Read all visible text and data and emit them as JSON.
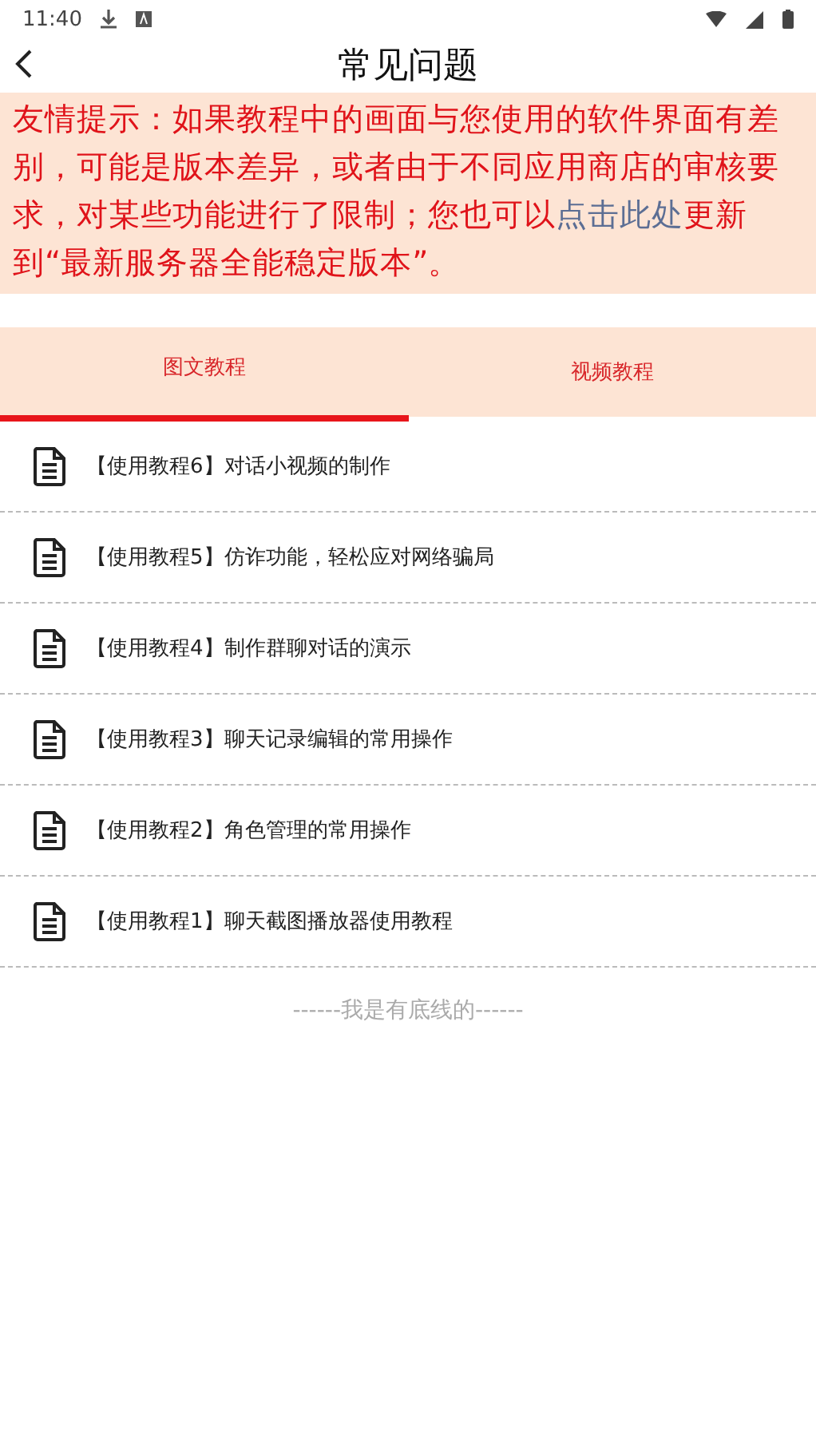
{
  "status_bar": {
    "time": "11:40"
  },
  "header": {
    "title": "常见问题"
  },
  "notice": {
    "before": "友情提示：如果教程中的画面与您使用的软件界面有差别，可能是版本差异，或者由于不同应用商店的审核要求，对某些功能进行了限制；您也可以",
    "link": "点击此处",
    "after": "更新到“最新服务器全能稳定版本”。"
  },
  "tabs": [
    {
      "label": "图文教程",
      "selected": true
    },
    {
      "label": "视频教程",
      "selected": false
    }
  ],
  "items": [
    {
      "title": "【使用教程6】对话小视频的制作"
    },
    {
      "title": "【使用教程5】仿诈功能，轻松应对网络骗局"
    },
    {
      "title": "【使用教程4】制作群聊对话的演示"
    },
    {
      "title": "【使用教程3】聊天记录编辑的常用操作"
    },
    {
      "title": "【使用教程2】角色管理的常用操作"
    },
    {
      "title": "【使用教程1】聊天截图播放器使用教程"
    }
  ],
  "footer": "------我是有底线的------"
}
